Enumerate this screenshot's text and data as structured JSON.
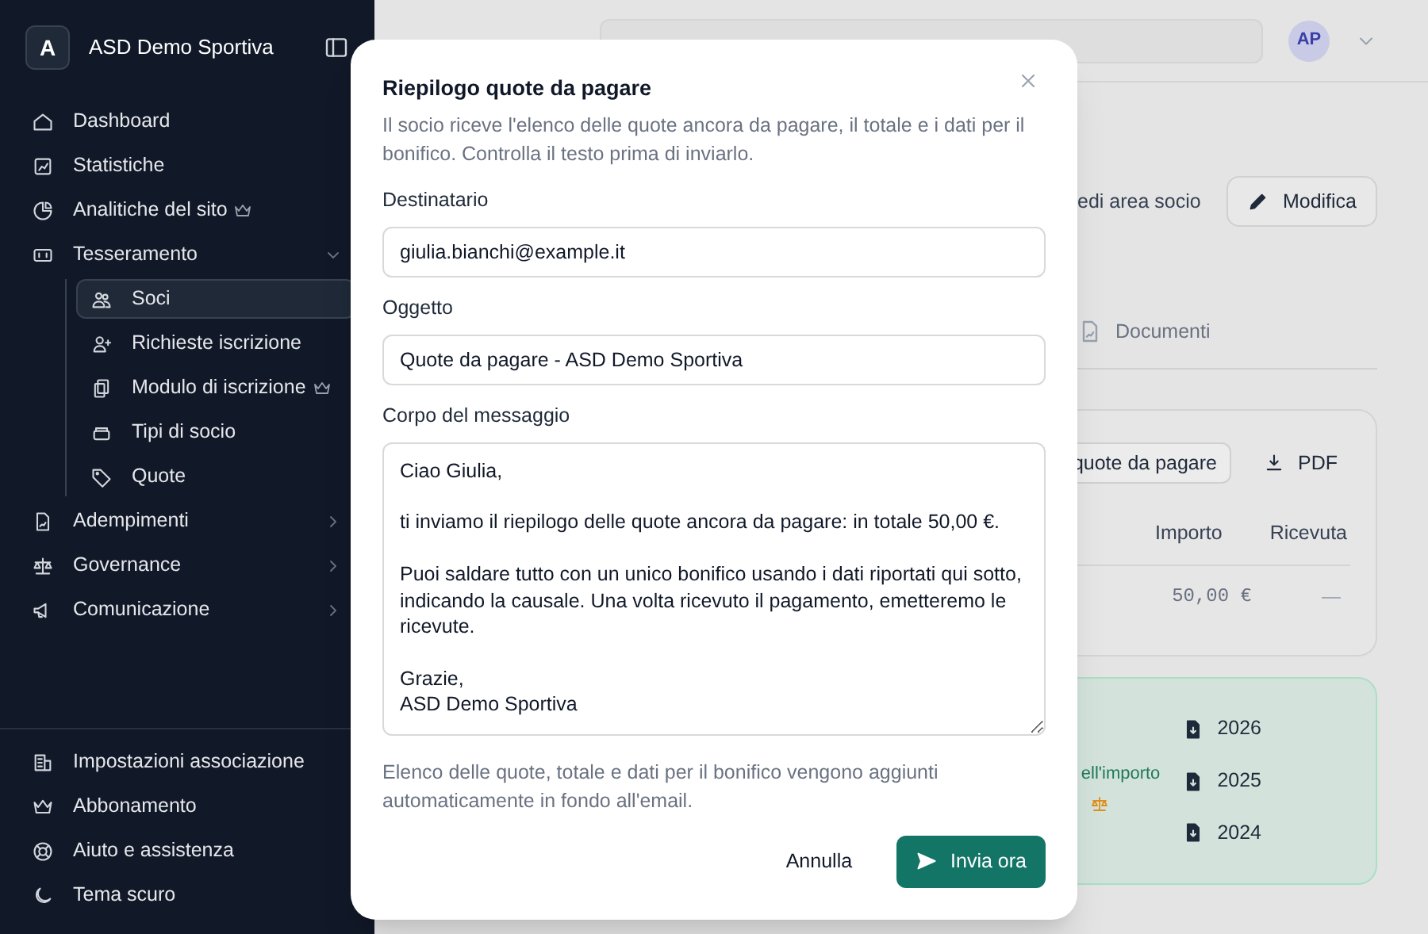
{
  "sidebar": {
    "brand": {
      "initial": "A",
      "name": "ASD Demo Sportiva"
    },
    "nav": [
      {
        "label": "Dashboard",
        "kind": "item",
        "selected": false
      },
      {
        "label": "Statistiche",
        "kind": "item",
        "selected": false
      },
      {
        "label": "Analitiche del sito",
        "kind": "item",
        "selected": false,
        "premium": true
      },
      {
        "label": "Tesseramento",
        "kind": "group",
        "expanded": true,
        "children": [
          {
            "label": "Soci",
            "selected": true
          },
          {
            "label": "Richieste iscrizione",
            "selected": false
          },
          {
            "label": "Modulo di iscrizione",
            "selected": false,
            "premium": true
          },
          {
            "label": "Tipi di socio",
            "selected": false
          },
          {
            "label": "Quote",
            "selected": false
          }
        ]
      },
      {
        "label": "Adempimenti",
        "kind": "group",
        "expanded": false
      },
      {
        "label": "Governance",
        "kind": "group",
        "expanded": false
      },
      {
        "label": "Comunicazione",
        "kind": "group",
        "expanded": false
      }
    ],
    "footer": [
      "Impostazioni associazione",
      "Abbonamento",
      "Aiuto e assistenza",
      "Tema scuro"
    ]
  },
  "topbar": {
    "avatar": "AP"
  },
  "background": {
    "link": "edi area socio",
    "edit_button": "Modifica",
    "tab": "Documenti",
    "card_buttons": [
      "quote da pagare",
      "PDF"
    ],
    "table": {
      "columns": [
        "Importo",
        "Ricevuta"
      ],
      "rows": [
        [
          "50,00 €",
          "—"
        ]
      ]
    },
    "notice": "ell'importo",
    "years": [
      "2026",
      "2025",
      "2024"
    ]
  },
  "modal": {
    "title": "Riepilogo quote da pagare",
    "description": "Il socio riceve l'elenco delle quote ancora da pagare, il totale e i dati per il bonifico. Controlla il testo prima di inviarlo.",
    "fields": [
      {
        "label": "Destinatario",
        "kind": "input",
        "value": "giulia.bianchi@example.it"
      },
      {
        "label": "Oggetto",
        "kind": "input",
        "value": "Quote da pagare - ASD Demo Sportiva"
      },
      {
        "label": "Corpo del messaggio",
        "kind": "textarea",
        "value": "Ciao Giulia,\n\nti inviamo il riepilogo delle quote ancora da pagare: in totale 50,00 €.\n\nPuoi saldare tutto con un unico bonifico usando i dati riportati qui sotto, indicando la causale. Una volta ricevuto il pagamento, emetteremo le ricevute.\n\nGrazie,\nASD Demo Sportiva"
      }
    ],
    "note": "Elenco delle quote, totale e dati per il bonifico vengono aggiunti automaticamente in fondo all'email.",
    "cancel": "Annulla",
    "submit": "Invia ora"
  }
}
